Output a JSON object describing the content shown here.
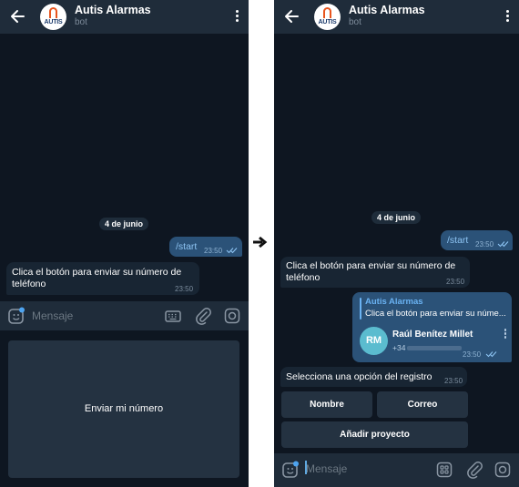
{
  "chat": {
    "title": "Autis Alarmas",
    "subtitle": "bot",
    "logo_text": "AUTIS"
  },
  "left": {
    "date": "4 de junio",
    "out_msg": {
      "text": "/start",
      "time": "23:50"
    },
    "in_msg": {
      "text_line1": "Clica el botón para enviar su número de",
      "text_line2": "teléfono",
      "time": "23:50"
    },
    "input_placeholder": "Mensaje",
    "keyboard_button": "Enviar mi número"
  },
  "right": {
    "date": "4 de junio",
    "out_msg": {
      "text": "/start",
      "time": "23:50"
    },
    "in_msg": {
      "text_line1": "Clica el botón para enviar su número de",
      "text_line2": "teléfono",
      "time": "23:50"
    },
    "contact": {
      "reply_name": "Autis Alarmas",
      "reply_text": "Clica el botón para enviar su núme...",
      "initials": "RM",
      "name": "Raúl Benítez Millet",
      "phone_prefix": "+34",
      "time": "23:50"
    },
    "select_msg": {
      "text": "Selecciona una opción del registro",
      "time": "23:50"
    },
    "buttons": [
      "Nombre",
      "Correo",
      "Añadir proyecto"
    ],
    "input_placeholder": "Mensaje"
  },
  "colors": {
    "background": "#0e1621",
    "header": "#1f2c3a",
    "outgoing_bubble": "#2b5278",
    "incoming_bubble": "#182533",
    "accent": "#6ab2f2",
    "logo_accent": "#e8551e"
  },
  "icons": [
    "back-arrow-icon",
    "more-vertical-icon",
    "sticker-icon",
    "keyboard-icon",
    "attach-icon",
    "camera-icon",
    "bot-keyboard-icon",
    "read-ticks-icon",
    "arrow-right-icon"
  ]
}
